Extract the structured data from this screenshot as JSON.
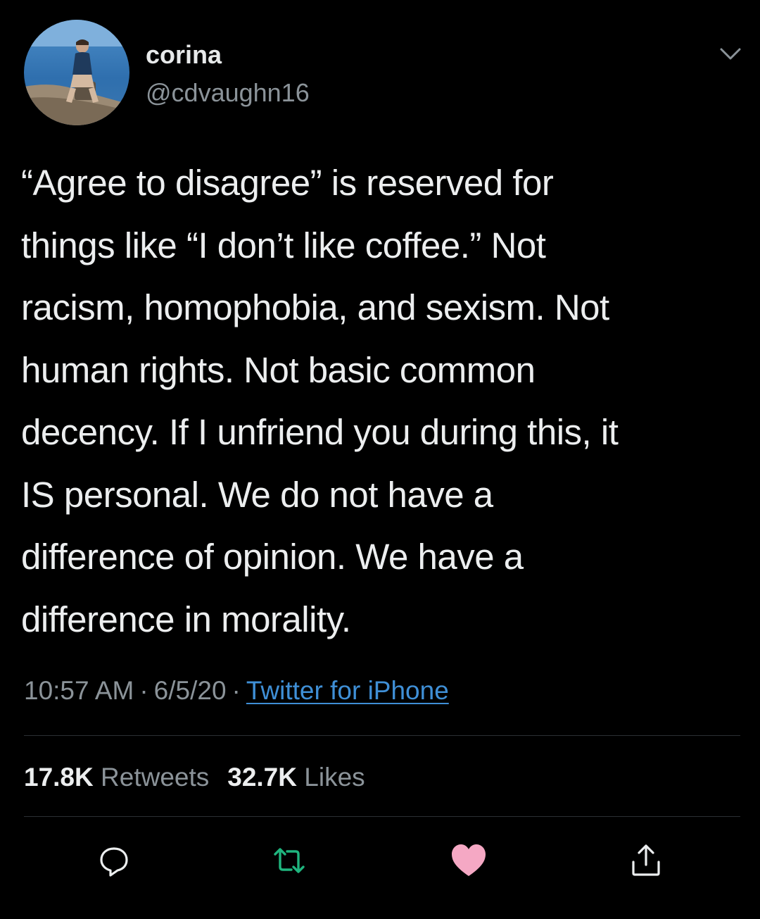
{
  "author": {
    "name": "corina",
    "handle": "@cdvaughn16",
    "avatar_icon": "profile-photo"
  },
  "tweet": {
    "lines": [
      "“Agree to disagree” is reserved for",
      "things like “I don’t like coffee.” Not",
      "racism, homophobia, and sexism. Not",
      "human rights. Not basic common",
      "decency. If I unfriend you during this, it",
      "IS personal. We do not have a",
      "difference of opinion. We have a",
      "difference in morality."
    ],
    "time": "10:57 AM",
    "date": "6/5/20",
    "separator": "·",
    "source": "Twitter for iPhone"
  },
  "stats": {
    "retweets_count": "17.8K",
    "retweets_label": "Retweets",
    "likes_count": "32.7K",
    "likes_label": "Likes"
  },
  "actions": {
    "reply_icon": "reply-icon",
    "retweet_icon": "retweet-icon",
    "like_icon": "heart-icon",
    "share_icon": "share-icon"
  },
  "colors": {
    "background": "#000000",
    "text": "#eceeef",
    "secondary": "#8b9399",
    "link": "#3f8fd6",
    "retweet": "#1fb57e",
    "like": "#f5a8c4"
  }
}
